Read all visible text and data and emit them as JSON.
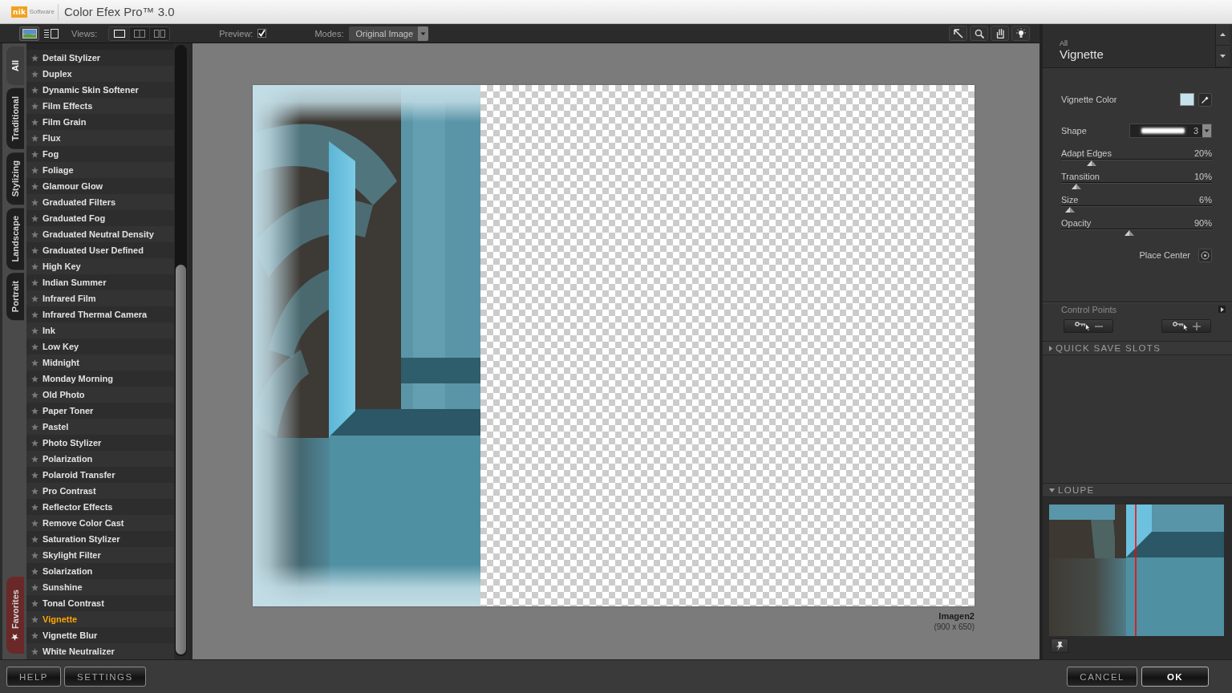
{
  "window": {
    "logo": {
      "mark": "nik",
      "caption": "Software"
    },
    "title": "Color Efex Pro™ 3.0"
  },
  "toolbar": {
    "browser_views": [
      {
        "kind": "thumbnails",
        "selected": true
      },
      {
        "kind": "list",
        "selected": false
      }
    ],
    "views_label": "Views:",
    "views": [
      {
        "kind": "single",
        "selected": true
      },
      {
        "kind": "split",
        "selected": false
      },
      {
        "kind": "side_by_side",
        "selected": false
      }
    ],
    "preview": {
      "label": "Preview:",
      "checked": true
    },
    "modes": {
      "label": "Modes:",
      "value": "Original Image"
    },
    "tools": [
      {
        "kind": "pointer"
      },
      {
        "kind": "zoom"
      },
      {
        "kind": "hand"
      },
      {
        "kind": "light"
      }
    ]
  },
  "category_tabs": [
    {
      "kind": "category",
      "label": "All",
      "selected": true
    },
    {
      "kind": "category",
      "label": "Traditional",
      "selected": false
    },
    {
      "kind": "category",
      "label": "Stylizing",
      "selected": false
    },
    {
      "kind": "category",
      "label": "Landscape",
      "selected": false
    },
    {
      "kind": "category",
      "label": "Portrait",
      "selected": false
    },
    {
      "kind": "favorites",
      "label": "Favorites",
      "selected": false
    }
  ],
  "filters": [
    {
      "label": "Detail Stylizer",
      "selected": false
    },
    {
      "label": "Duplex",
      "selected": false
    },
    {
      "label": "Dynamic Skin Softener",
      "selected": false
    },
    {
      "label": "Film Effects",
      "selected": false
    },
    {
      "label": "Film Grain",
      "selected": false
    },
    {
      "label": "Flux",
      "selected": false
    },
    {
      "label": "Fog",
      "selected": false
    },
    {
      "label": "Foliage",
      "selected": false
    },
    {
      "label": "Glamour Glow",
      "selected": false
    },
    {
      "label": "Graduated Filters",
      "selected": false
    },
    {
      "label": "Graduated Fog",
      "selected": false
    },
    {
      "label": "Graduated Neutral Density",
      "selected": false
    },
    {
      "label": "Graduated User Defined",
      "selected": false
    },
    {
      "label": "High Key",
      "selected": false
    },
    {
      "label": "Indian Summer",
      "selected": false
    },
    {
      "label": "Infrared Film",
      "selected": false
    },
    {
      "label": "Infrared Thermal Camera",
      "selected": false
    },
    {
      "label": "Ink",
      "selected": false
    },
    {
      "label": "Low Key",
      "selected": false
    },
    {
      "label": "Midnight",
      "selected": false
    },
    {
      "label": "Monday Morning",
      "selected": false
    },
    {
      "label": "Old Photo",
      "selected": false
    },
    {
      "label": "Paper Toner",
      "selected": false
    },
    {
      "label": "Pastel",
      "selected": false
    },
    {
      "label": "Photo Stylizer",
      "selected": false
    },
    {
      "label": "Polarization",
      "selected": false
    },
    {
      "label": "Polaroid Transfer",
      "selected": false
    },
    {
      "label": "Pro Contrast",
      "selected": false
    },
    {
      "label": "Reflector Effects",
      "selected": false
    },
    {
      "label": "Remove Color Cast",
      "selected": false
    },
    {
      "label": "Saturation Stylizer",
      "selected": false
    },
    {
      "label": "Skylight Filter",
      "selected": false
    },
    {
      "label": "Solarization",
      "selected": false
    },
    {
      "label": "Sunshine",
      "selected": false
    },
    {
      "label": "Tonal Contrast",
      "selected": false
    },
    {
      "label": "Vignette",
      "selected": true
    },
    {
      "label": "Vignette Blur",
      "selected": false
    },
    {
      "label": "White Neutralizer",
      "selected": false
    }
  ],
  "preview_area": {
    "image_name": "Imagen2",
    "image_size": "(900 x 650)"
  },
  "filter_panel": {
    "category": "All",
    "title": "Vignette",
    "controls": [
      {
        "kind": "color",
        "label": "Vignette Color",
        "color": "#c4e2ec"
      },
      {
        "kind": "dropdown",
        "label": "Shape",
        "value": "3"
      },
      {
        "kind": "slider",
        "label": "Adapt Edges",
        "reading": "20%",
        "level": 0.2
      },
      {
        "kind": "slider",
        "label": "Transition",
        "reading": "10%",
        "level": 0.1
      },
      {
        "kind": "slider",
        "label": "Size",
        "reading": "6%",
        "level": 0.06
      },
      {
        "kind": "slider",
        "label": "Opacity",
        "reading": "90%",
        "level": 0.45
      },
      {
        "kind": "button",
        "label": "Place Center"
      }
    ],
    "control_points": {
      "label": "Control Points",
      "buttons": [
        {
          "kind": "remove"
        },
        {
          "kind": "add"
        }
      ]
    }
  },
  "sections": [
    {
      "kind": "quick_save",
      "label": "QUICK SAVE SLOTS",
      "expanded": false
    },
    {
      "kind": "loupe",
      "label": "LOUPE",
      "expanded": true
    }
  ],
  "footer": {
    "left_buttons": [
      "HELP",
      "SETTINGS"
    ],
    "right_buttons": [
      {
        "kind": "secondary",
        "label": "CANCEL"
      },
      {
        "kind": "primary",
        "label": "OK"
      }
    ]
  }
}
